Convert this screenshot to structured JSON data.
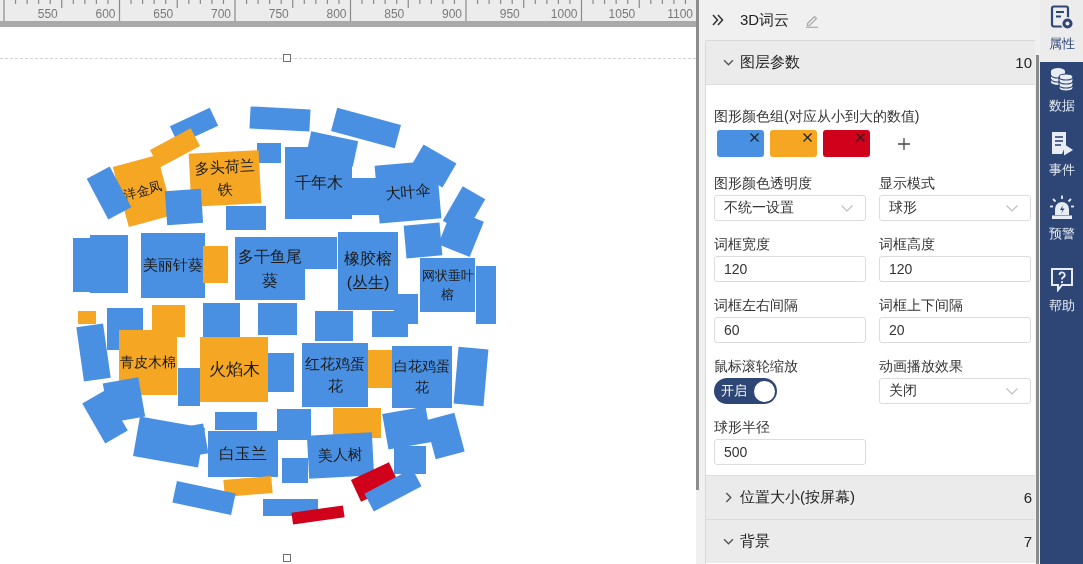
{
  "ruler": {
    "labels": [
      "550",
      "600",
      "650",
      "700",
      "750",
      "800",
      "850",
      "900",
      "950",
      "1000",
      "1050",
      "1100"
    ]
  },
  "canvas": {
    "word_cloud": {
      "tiles": [
        {
          "color": "#4a90e2"
        },
        {
          "color": "#4a90e2"
        },
        {
          "color": "#4a90e2"
        },
        {
          "color": "#4a90e2"
        },
        {
          "color": "#f5a623"
        },
        {
          "color": "#4a90e2"
        },
        {
          "color": "#4a90e2"
        },
        {
          "text": "多头荷兰铁",
          "color": "#f5a623"
        },
        {
          "text": "千年木",
          "color": "#4a90e2"
        },
        {
          "text": "洋金凤",
          "color": "#f5a623"
        },
        {
          "color": "#4a90e2"
        },
        {
          "text": "大叶伞",
          "color": "#4a90e2"
        },
        {
          "color": "#4a90e2"
        },
        {
          "color": "#4a90e2"
        },
        {
          "color": "#4a90e2"
        },
        {
          "color": "#4a90e2"
        },
        {
          "color": "#4a90e2"
        },
        {
          "color": "#4a90e2"
        },
        {
          "color": "#4a90e2"
        },
        {
          "color": "#4a90e2"
        },
        {
          "text": "美丽针葵",
          "color": "#4a90e2"
        },
        {
          "color": "#f5a623"
        },
        {
          "text": "多干鱼尾葵",
          "color": "#4a90e2"
        },
        {
          "color": "#4a90e2"
        },
        {
          "text": "橡胶榕(丛生)",
          "color": "#4a90e2"
        },
        {
          "text": "网状垂叶榕",
          "color": "#4a90e2"
        },
        {
          "color": "#4a90e2"
        },
        {
          "color": "#4a90e2"
        },
        {
          "color": "#f5a623"
        },
        {
          "color": "#4a90e2"
        },
        {
          "color": "#f5a623"
        },
        {
          "color": "#4a90e2"
        },
        {
          "color": "#4a90e2"
        },
        {
          "color": "#4a90e2"
        },
        {
          "color": "#4a90e2"
        },
        {
          "color": "#4a90e2"
        },
        {
          "text": "青皮木棉",
          "color": "#f5a623"
        },
        {
          "text": "火焰木",
          "color": "#f5a623"
        },
        {
          "color": "#4a90e2"
        },
        {
          "text": "红花鸡蛋花",
          "color": "#4a90e2"
        },
        {
          "color": "#f5a623"
        },
        {
          "text": "白花鸡蛋花",
          "color": "#4a90e2"
        },
        {
          "color": "#4a90e2"
        },
        {
          "color": "#4a90e2"
        },
        {
          "color": "#4a90e2"
        },
        {
          "color": "#4a90e2"
        },
        {
          "color": "#4a90e2"
        },
        {
          "color": "#f5a623"
        },
        {
          "color": "#4a90e2"
        },
        {
          "color": "#4a90e2"
        },
        {
          "color": "#4a90e2"
        },
        {
          "color": "#4a90e2"
        },
        {
          "color": "#4a90e2"
        },
        {
          "text": "白玉兰",
          "color": "#4a90e2"
        },
        {
          "text": "美人树",
          "color": "#4a90e2"
        },
        {
          "color": "#4a90e2"
        },
        {
          "color": "#d0021b"
        },
        {
          "color": "#4a90e2"
        },
        {
          "color": "#f5a623"
        },
        {
          "color": "#4a90e2"
        },
        {
          "color": "#4a90e2"
        },
        {
          "color": "#4a90e2"
        },
        {
          "color": "#d0021b"
        }
      ]
    }
  },
  "panel": {
    "title": "3D词云",
    "sections": [
      {
        "title": "图层参数",
        "count": "10",
        "expanded": true,
        "fields": [
          {
            "kind": "colors",
            "label": "图形颜色组(对应从小到大的数值)",
            "colors": [
              {
                "color": "#4a90e2"
              },
              {
                "color": "#f5a623"
              },
              {
                "color": "#d0021b"
              }
            ]
          },
          {
            "kind": "select",
            "label": "图形颜色透明度",
            "value": "不统一设置"
          },
          {
            "kind": "select",
            "label": "显示模式",
            "value": "球形"
          },
          {
            "kind": "input",
            "label": "词框宽度",
            "value": "120"
          },
          {
            "kind": "input",
            "label": "词框高度",
            "value": "120"
          },
          {
            "kind": "input",
            "label": "词框左右间隔",
            "value": "60"
          },
          {
            "kind": "input",
            "label": "词框上下间隔",
            "value": "20"
          },
          {
            "kind": "toggle",
            "label": "鼠标滚轮缩放",
            "on": true,
            "text": "开启"
          },
          {
            "kind": "select",
            "label": "动画播放效果",
            "value": "关闭"
          },
          {
            "kind": "input",
            "label": "球形半径",
            "value": "500"
          }
        ]
      },
      {
        "title": "位置大小(按屏幕)",
        "count": "6",
        "expanded": false
      },
      {
        "title": "背景",
        "count": "7",
        "expanded": true
      }
    ]
  },
  "sidebar": {
    "items": [
      {
        "label": "属性",
        "selected": true
      },
      {
        "label": "数据",
        "selected": false
      },
      {
        "label": "事件",
        "selected": false
      },
      {
        "label": "预警",
        "selected": false
      },
      {
        "label": "帮助",
        "selected": false
      }
    ]
  }
}
